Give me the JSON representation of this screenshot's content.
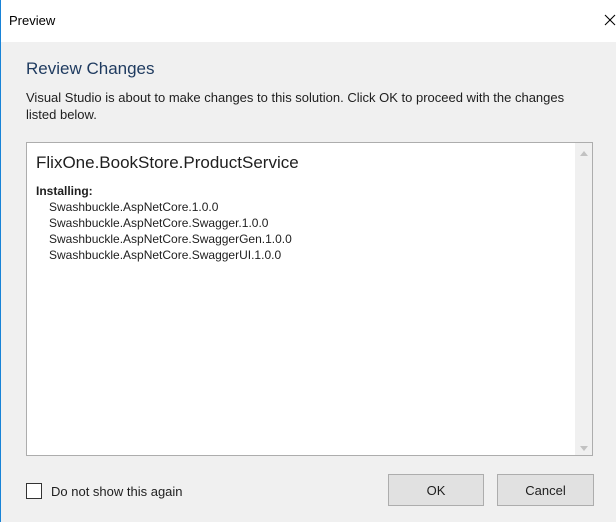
{
  "window": {
    "title": "Preview",
    "close_icon": "close-icon"
  },
  "header": {
    "heading": "Review Changes",
    "description": "Visual Studio is about to make changes to this solution. Click OK to proceed with the changes listed below."
  },
  "changes": {
    "project": "FlixOne.BookStore.ProductService",
    "installing_label": "Installing:",
    "packages": [
      "Swashbuckle.AspNetCore.1.0.0",
      "Swashbuckle.AspNetCore.Swagger.1.0.0",
      "Swashbuckle.AspNetCore.SwaggerGen.1.0.0",
      "Swashbuckle.AspNetCore.SwaggerUI.1.0.0"
    ]
  },
  "footer": {
    "checkbox_label": "Do not show this again",
    "checkbox_checked": false,
    "ok_label": "OK",
    "cancel_label": "Cancel"
  },
  "colors": {
    "accent_border": "#1883d7",
    "content_background": "#f0f0f0",
    "heading_color": "#1e3a5f"
  }
}
